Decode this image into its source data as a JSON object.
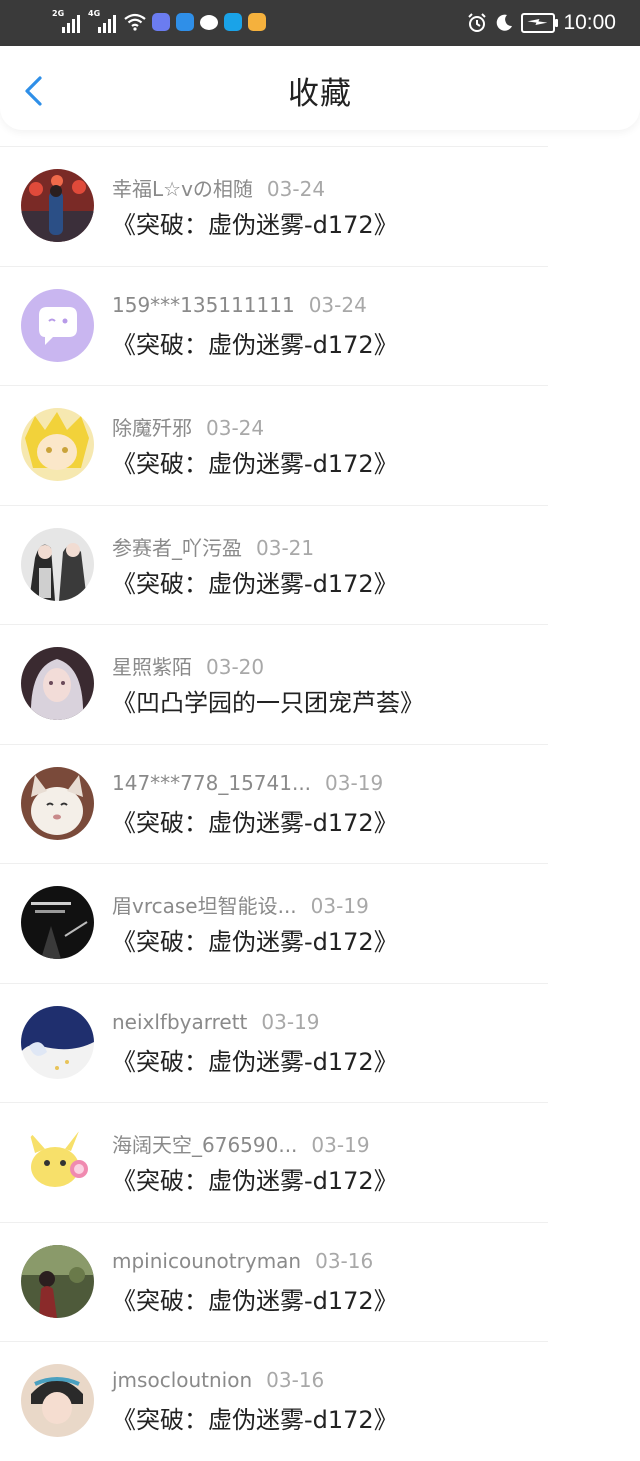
{
  "status_bar": {
    "time": "10:00",
    "signal_1_gen": "2G",
    "signal_2_gen": "4G",
    "app_icons": [
      "music-app-icon",
      "cloud-app-icon",
      "chat-app-icon",
      "search-app-icon",
      "photo-app-icon"
    ]
  },
  "header": {
    "title": "收藏",
    "back_icon": "chevron-left-icon"
  },
  "colors": {
    "accent": "#2f8fe8",
    "title_text": "#222222",
    "meta_text": "#8a8a8a",
    "status_bar_bg": "#3a3a3a"
  },
  "favorites": [
    {
      "user": "幸福L☆vの相随",
      "date": "03-24",
      "title": "《突破：虚伪迷雾-d172》"
    },
    {
      "user": "159***135111111",
      "date": "03-24",
      "title": "《突破：虚伪迷雾-d172》"
    },
    {
      "user": "除魔歼邪",
      "date": "03-24",
      "title": "《突破：虚伪迷雾-d172》"
    },
    {
      "user": "参赛者_吖污盈",
      "date": "03-21",
      "title": "《突破：虚伪迷雾-d172》"
    },
    {
      "user": "星照紫陌",
      "date": "03-20",
      "title": "《凹凸学园的一只团宠芦荟》"
    },
    {
      "user": "147***778_15741...",
      "date": "03-19",
      "title": "《突破：虚伪迷雾-d172》"
    },
    {
      "user": "眉vrcase坦智能设...",
      "date": "03-19",
      "title": "《突破：虚伪迷雾-d172》"
    },
    {
      "user": "neixlfbyarrett",
      "date": "03-19",
      "title": "《突破：虚伪迷雾-d172》"
    },
    {
      "user": "海阔天空_676590...",
      "date": "03-19",
      "title": "《突破：虚伪迷雾-d172》"
    },
    {
      "user": "mpinicounotryman",
      "date": "03-16",
      "title": "《突破：虚伪迷雾-d172》"
    },
    {
      "user": "jmsocloutnion",
      "date": "03-16",
      "title": "《突破：虚伪迷雾-d172》"
    }
  ]
}
